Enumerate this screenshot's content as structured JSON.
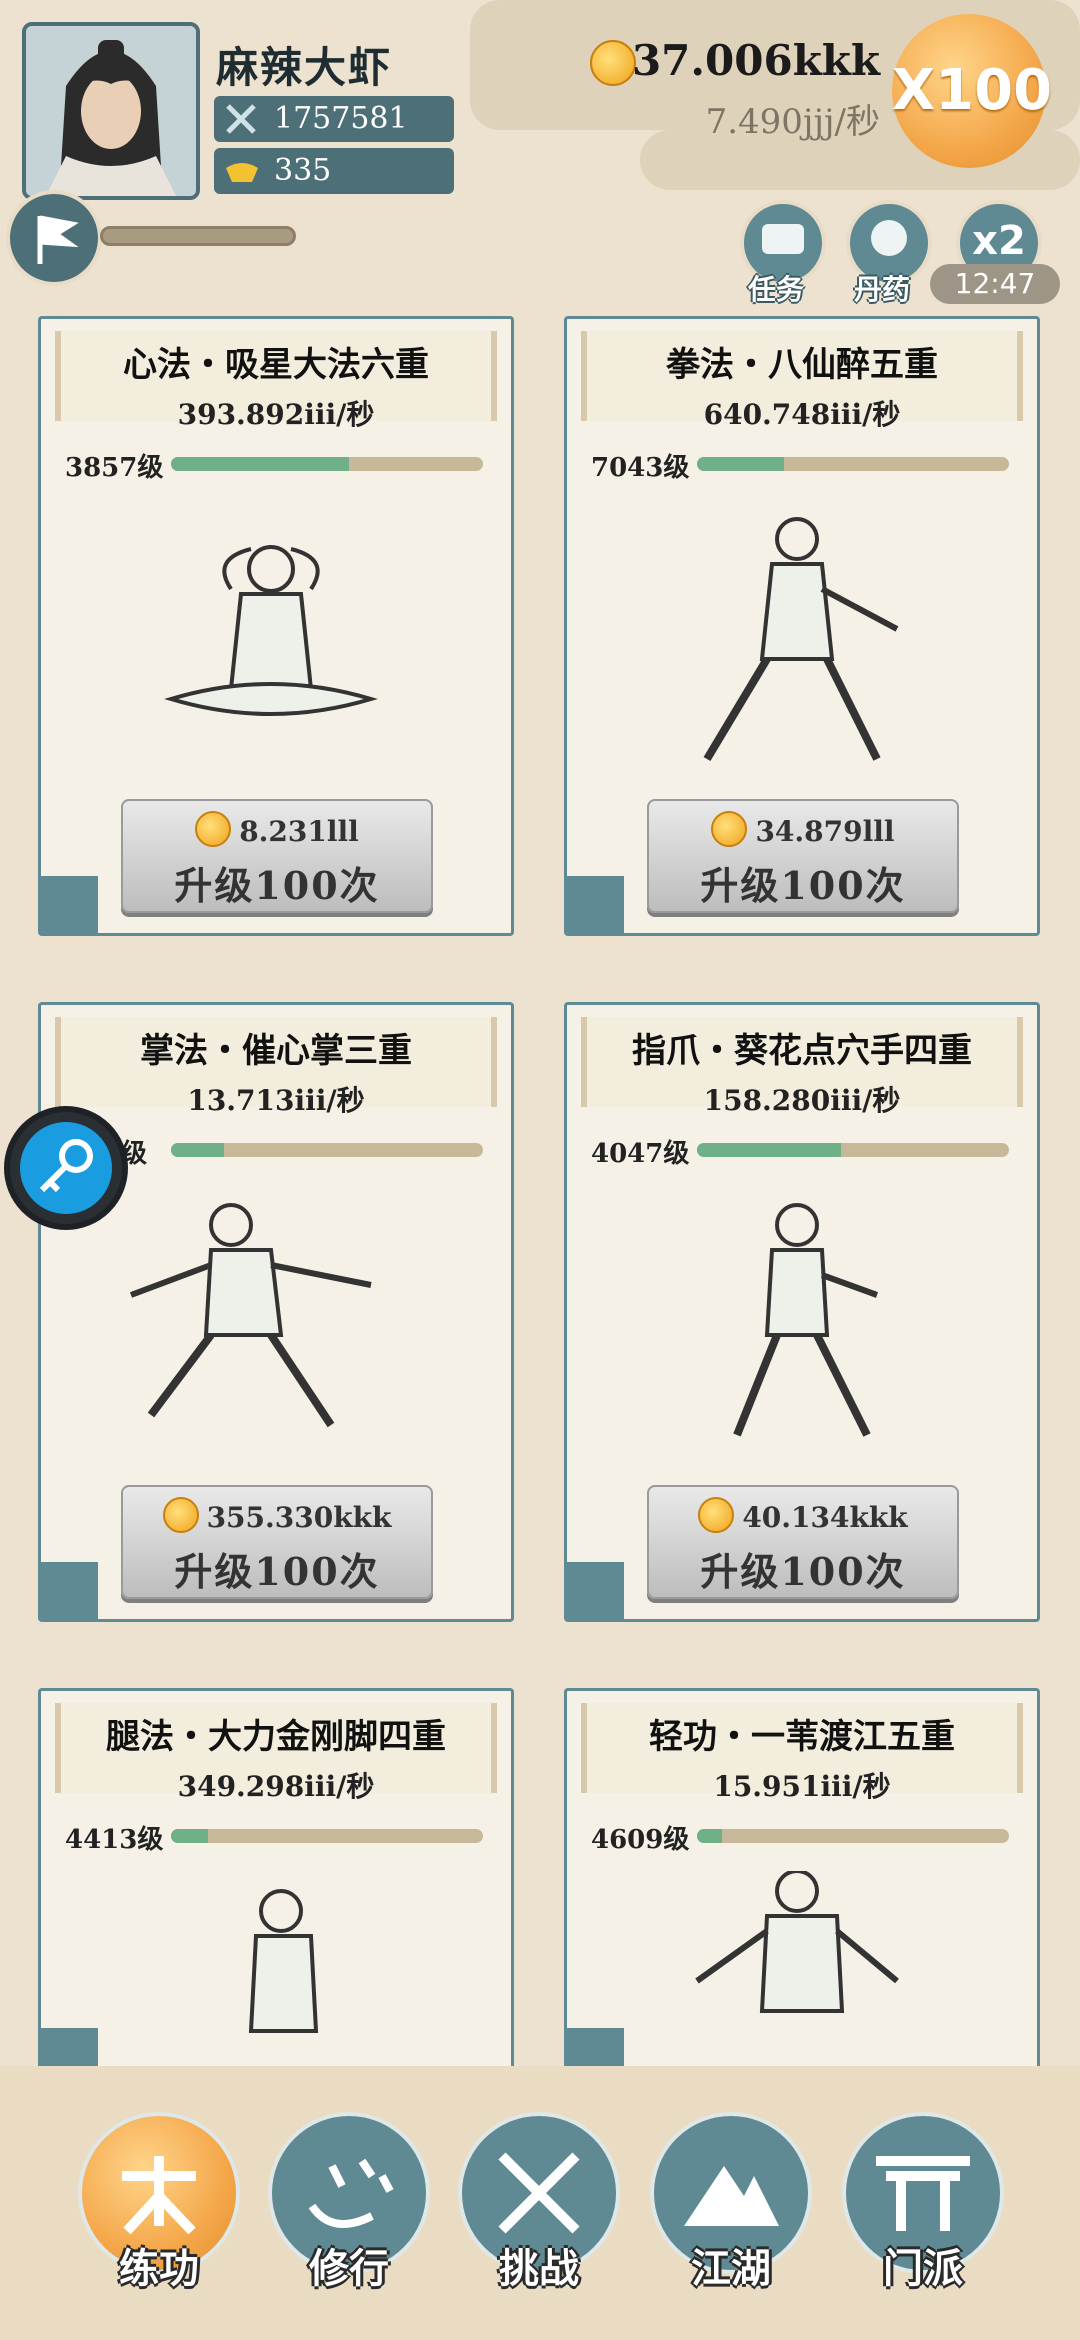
{
  "player": {
    "name": "麻辣大虾",
    "power": "1757581",
    "ingots": "335"
  },
  "currency": {
    "gold": "37.006kkk",
    "rate": "7.490jjj/秒",
    "multiplier": "X100"
  },
  "quick_buttons": [
    {
      "label": "任务",
      "icon": "scroll-icon"
    },
    {
      "label": "丹药",
      "icon": "pill-icon"
    },
    {
      "label": "x2",
      "icon": "x2-icon"
    }
  ],
  "timer": "12:47",
  "skills": [
    {
      "title": "心法・吸星大法六重",
      "rate": "393.892iii/秒",
      "level": "3857级",
      "progress": 0.57,
      "cost": "8.231lll",
      "button": "升级100次"
    },
    {
      "title": "拳法・八仙醉五重",
      "rate": "640.748iii/秒",
      "level": "7043级",
      "progress": 0.28,
      "cost": "34.879lll",
      "button": "升级100次"
    },
    {
      "title": "掌法・催心掌三重",
      "rate": "13.713iii/秒",
      "level": "级",
      "progress": 0.17,
      "cost": "355.330kkk",
      "button": "升级100次"
    },
    {
      "title": "指爪・葵花点穴手四重",
      "rate": "158.280iii/秒",
      "level": "4047级",
      "progress": 0.46,
      "cost": "40.134kkk",
      "button": "升级100次"
    },
    {
      "title": "腿法・大力金刚脚四重",
      "rate": "349.298iii/秒",
      "level": "4413级",
      "progress": 0.12,
      "cost": "",
      "button": ""
    },
    {
      "title": "轻功・一苇渡江五重",
      "rate": "15.951iii/秒",
      "level": "4609级",
      "progress": 0.08,
      "cost": "",
      "button": ""
    }
  ],
  "nav": [
    {
      "label": "练功",
      "icon": "practice-icon",
      "active": true
    },
    {
      "label": "修行",
      "icon": "heart-mind-icon",
      "active": false
    },
    {
      "label": "挑战",
      "icon": "crossed-swords-icon",
      "active": false
    },
    {
      "label": "江湖",
      "icon": "mountain-icon",
      "active": false
    },
    {
      "label": "门派",
      "icon": "gate-icon",
      "active": false
    }
  ],
  "colors": {
    "background": "#ece2cf",
    "teal": "#5f8a93",
    "orange": "#f4a74a",
    "progress": "#6fb088"
  }
}
